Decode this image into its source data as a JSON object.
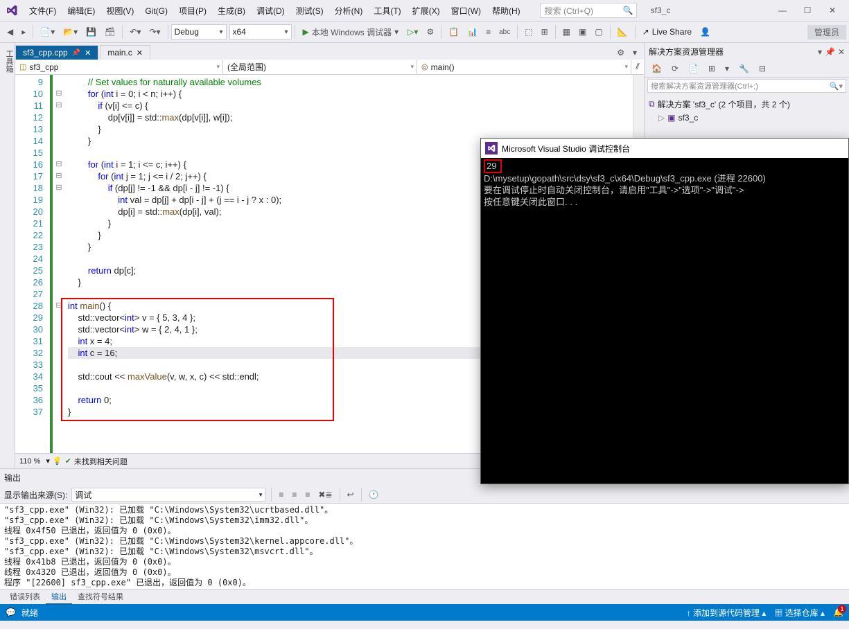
{
  "menus": [
    "文件(F)",
    "编辑(E)",
    "视图(V)",
    "Git(G)",
    "项目(P)",
    "生成(B)",
    "调试(D)",
    "测试(S)",
    "分析(N)",
    "工具(T)",
    "扩展(X)",
    "窗口(W)",
    "帮助(H)"
  ],
  "search_placeholder": "搜索 (Ctrl+Q)",
  "window_title": "sf3_c",
  "config": "Debug",
  "platform": "x64",
  "run_label": "本地 Windows 调试器",
  "live_share": "Live Share",
  "admin": "管理员",
  "vertical_tab": "工具箱",
  "tabs": [
    {
      "label": "sf3_cpp.cpp",
      "active": true,
      "pinned": true
    },
    {
      "label": "main.c",
      "active": false,
      "pinned": false
    }
  ],
  "context": {
    "project": "sf3_cpp",
    "scope": "(全局范围)",
    "func": "main()"
  },
  "line_start": 9,
  "line_end": 37,
  "code_lines": [
    {
      "html": "        <span class='comment'>// Set values for naturally available volumes</span>"
    },
    {
      "html": "        <span class='kw'>for</span> (<span class='kw'>int</span> i = 0; i &lt; n; i++) {",
      "fold": "⊟"
    },
    {
      "html": "            <span class='kw'>if</span> (v[i] &lt;= c) {",
      "fold": "⊟"
    },
    {
      "html": "                dp[v[i]] = std::<span class='func'>max</span>(dp[v[i]], w[i]);"
    },
    {
      "html": "            }"
    },
    {
      "html": "        }"
    },
    {
      "html": ""
    },
    {
      "html": "        <span class='kw'>for</span> (<span class='kw'>int</span> i = 1; i &lt;= c; i++) {",
      "fold": "⊟"
    },
    {
      "html": "            <span class='kw'>for</span> (<span class='kw'>int</span> j = 1; j &lt;= i / 2; j++) {",
      "fold": "⊟"
    },
    {
      "html": "                <span class='kw'>if</span> (dp[j] != -1 &amp;&amp; dp[i - j] != -1) {",
      "fold": "⊟"
    },
    {
      "html": "                    <span class='kw'>int</span> val = dp[j] + dp[i - j] + (j == i - j ? x : 0);"
    },
    {
      "html": "                    dp[i] = std::<span class='func'>max</span>(dp[i], val);"
    },
    {
      "html": "                }"
    },
    {
      "html": "            }"
    },
    {
      "html": "        }"
    },
    {
      "html": ""
    },
    {
      "html": "        <span class='kw'>return</span> dp[c];"
    },
    {
      "html": "    }"
    },
    {
      "html": ""
    },
    {
      "html": "<span class='kw'>int</span> <span class='func'>main</span>() {",
      "fold": "⊟"
    },
    {
      "html": "    std::vector&lt;<span class='kw'>int</span>&gt; v = { 5, 3, 4 };"
    },
    {
      "html": "    std::vector&lt;<span class='kw'>int</span>&gt; w = { 2, 4, 1 };"
    },
    {
      "html": "    <span class='kw'>int</span> x = 4;"
    },
    {
      "html": "    <span class='kw'>int</span> c = 16;",
      "highlight": true
    },
    {
      "html": ""
    },
    {
      "html": "    std::cout &lt;&lt; <span class='func'>maxValue</span>(v, w, x, c) &lt;&lt; std::endl;"
    },
    {
      "html": ""
    },
    {
      "html": "    <span class='kw'>return</span> 0;"
    },
    {
      "html": "}"
    }
  ],
  "zoom": "110 %",
  "no_issues": "未找到相关问题",
  "solution_explorer": {
    "title": "解决方案资源管理器",
    "search_placeholder": "搜索解决方案资源管理器(Ctrl+;)",
    "root": "解决方案 'sf3_c' (2 个项目，共 2 个)",
    "items": [
      "sf3_c"
    ]
  },
  "output": {
    "title": "输出",
    "source_label": "显示输出来源(S):",
    "source_value": "调试",
    "lines": [
      "\"sf3_cpp.exe\" (Win32): 已加载 \"C:\\Windows\\System32\\ucrtbased.dll\"。",
      "\"sf3_cpp.exe\" (Win32): 已加载 \"C:\\Windows\\System32\\imm32.dll\"。",
      "线程 0x4f50 已退出，返回值为 0 (0x0)。",
      "\"sf3_cpp.exe\" (Win32): 已加载 \"C:\\Windows\\System32\\kernel.appcore.dll\"。",
      "\"sf3_cpp.exe\" (Win32): 已加载 \"C:\\Windows\\System32\\msvcrt.dll\"。",
      "线程 0x41b8 已退出，返回值为 0 (0x0)。",
      "线程 0x4320 已退出，返回值为 0 (0x0)。",
      "程序 \"[22600] sf3_cpp.exe\" 已退出，返回值为 0 (0x0)。"
    ]
  },
  "bottom_tabs": [
    "错误列表",
    "输出",
    "查找符号结果"
  ],
  "status": {
    "ready": "就绪",
    "scm": "添加到源代码管理",
    "repo": "选择仓库"
  },
  "console": {
    "title": "Microsoft Visual Studio 调试控制台",
    "output_value": "29",
    "body": "\nD:\\mysetup\\gopath\\src\\dsy\\sf3_c\\x64\\Debug\\sf3_cpp.exe (进程 22600)\n要在调试停止时自动关闭控制台，请启用\"工具\"->\"选项\"->\"调试\"->\n按任意键关闭此窗口. . ."
  }
}
